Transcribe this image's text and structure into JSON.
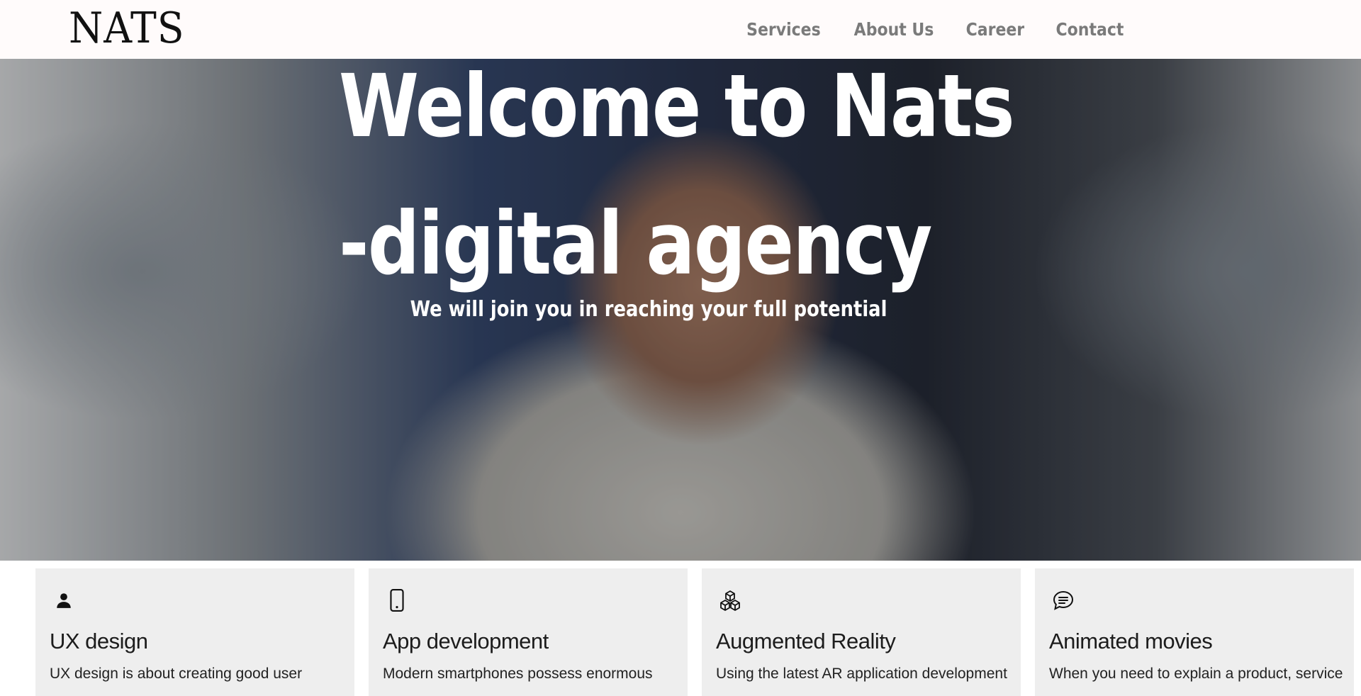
{
  "header": {
    "logo": "NATS",
    "nav": [
      {
        "label": "Services"
      },
      {
        "label": "About Us"
      },
      {
        "label": "Career"
      },
      {
        "label": "Contact"
      }
    ]
  },
  "hero": {
    "title_line1": "Welcome to Nats",
    "title_line2": "-digital agency",
    "subtitle": "We will join you in reaching your full potential"
  },
  "cards": [
    {
      "icon": "person-icon",
      "title": "UX design",
      "text": "UX design is about creating good user"
    },
    {
      "icon": "smartphone-icon",
      "title": "App development",
      "text": "Modern smartphones possess enormous"
    },
    {
      "icon": "cubes-icon",
      "title": "Augmented Reality",
      "text": "Using the latest AR application development"
    },
    {
      "icon": "chat-icon",
      "title": "Animated movies",
      "text": "When you need to explain a product, service"
    }
  ]
}
